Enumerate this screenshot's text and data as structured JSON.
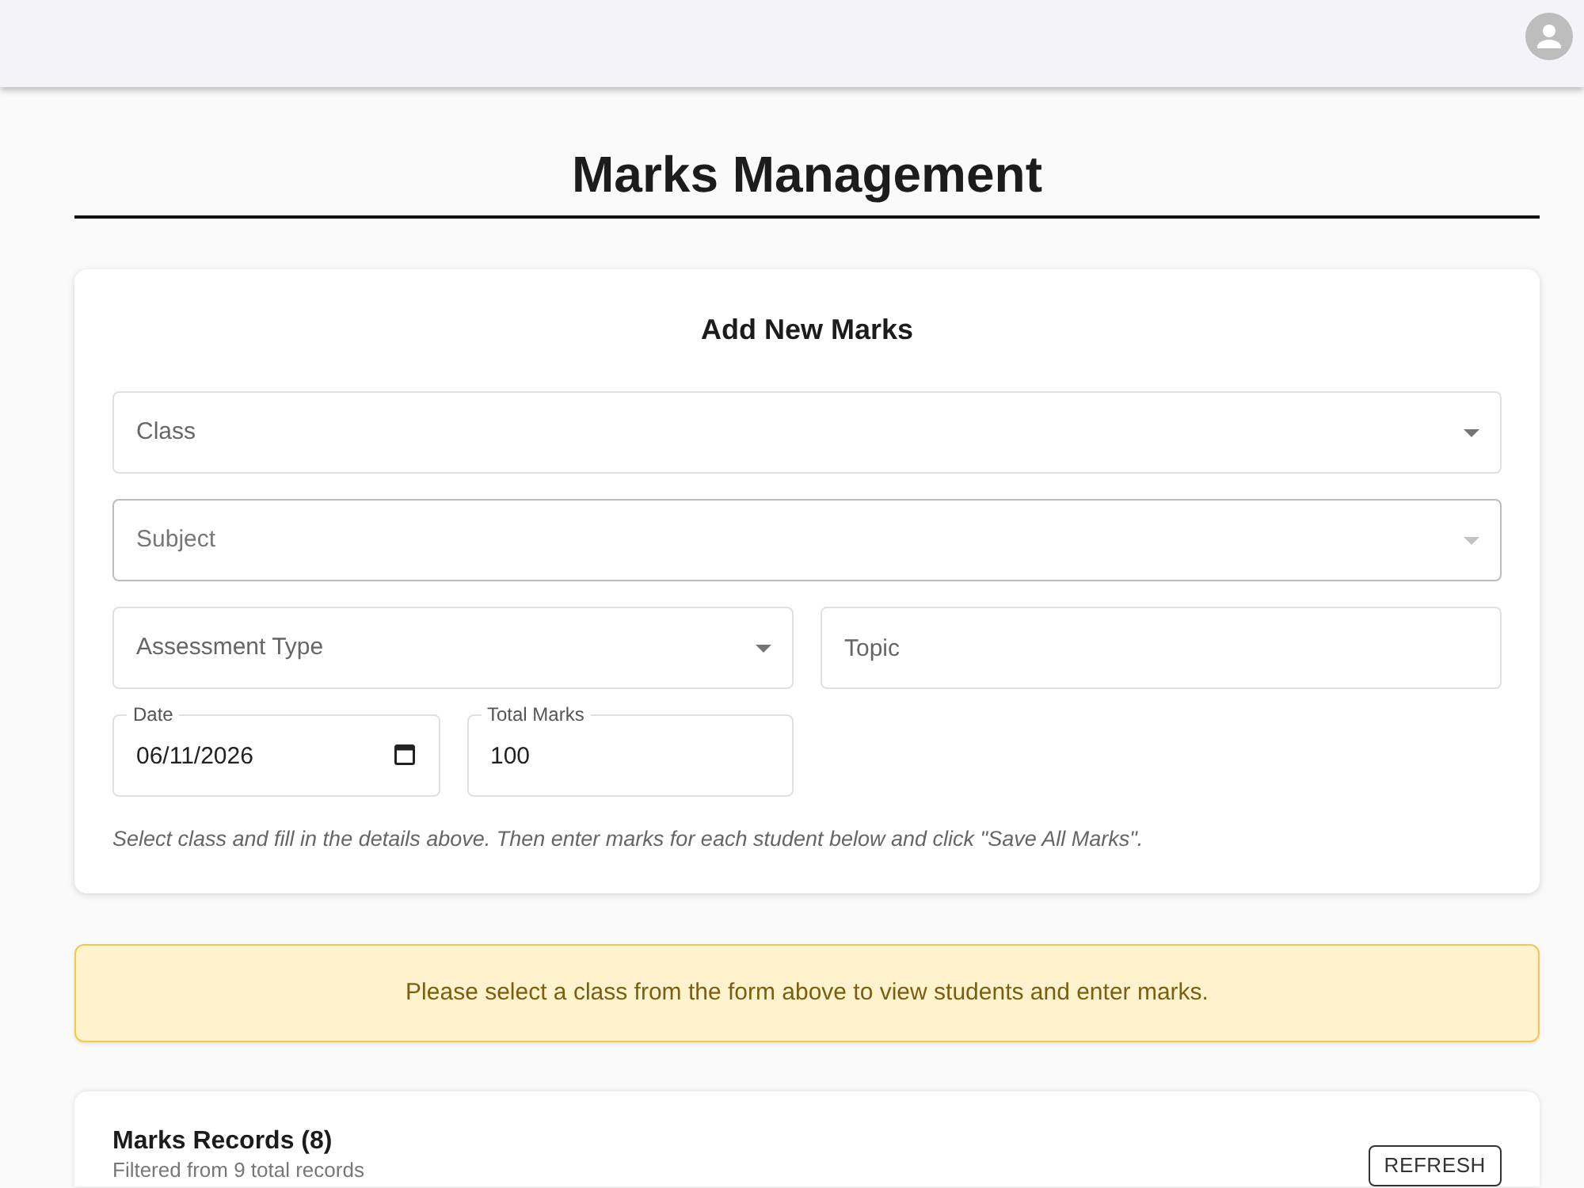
{
  "page": {
    "title": "Marks Management"
  },
  "form": {
    "title": "Add New Marks",
    "fields": [
      {
        "kind": "select",
        "label": "Class",
        "hovered": false,
        "disabled": false
      },
      {
        "kind": "select",
        "label": "Subject",
        "hovered": true,
        "disabled": true
      },
      {
        "kind": "select",
        "label": "Assessment Type",
        "hovered": false,
        "disabled": false
      },
      {
        "kind": "text",
        "placeholder": "Topic",
        "hovered": false,
        "disabled": false
      },
      {
        "kind": "date",
        "label": "Date",
        "value": "06/11/2026",
        "hovered": false,
        "disabled": false
      },
      {
        "kind": "number",
        "label": "Total Marks",
        "value": "100",
        "hovered": false,
        "disabled": false
      }
    ],
    "hint": "Select class and fill in the details above. Then enter marks for each student below and click \"Save All Marks\"."
  },
  "alert": {
    "message": "Please select a class from the form above to view students and enter marks."
  },
  "records": {
    "title": "Marks Records (8)",
    "subtitle": "Filtered from 9 total records",
    "refresh_button": "REFRESH"
  }
}
